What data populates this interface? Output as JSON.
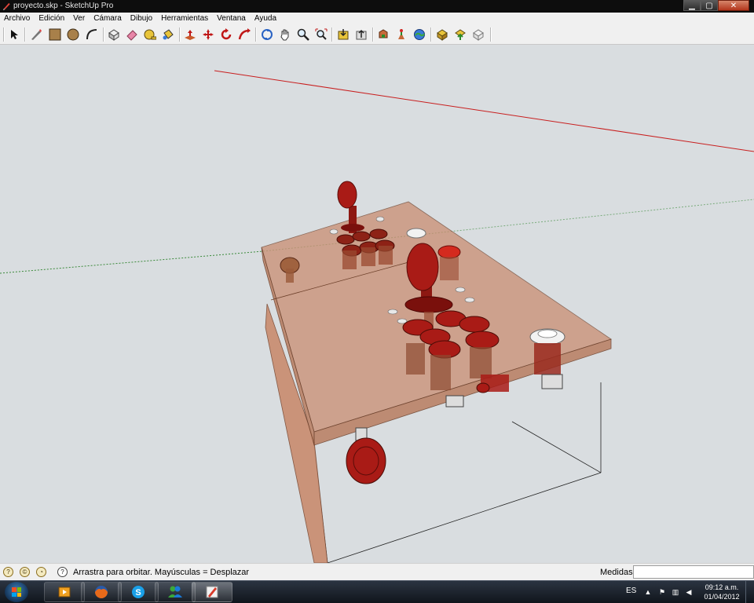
{
  "window": {
    "title": "proyecto.skp - SketchUp Pro"
  },
  "window_controls": {
    "minimize": "▁",
    "maximize": "▢",
    "close": "✕"
  },
  "menu": [
    "Archivo",
    "Edición",
    "Ver",
    "Cámara",
    "Dibujo",
    "Herramientas",
    "Ventana",
    "Ayuda"
  ],
  "toolbar": {
    "tools": [
      "select-icon",
      "pencil-line-icon",
      "rectangle-icon",
      "circle-icon",
      "arc-icon",
      "make-component-icon",
      "eraser-icon",
      "tape-measure-icon",
      "paint-bucket-icon",
      "push-pull-icon",
      "move-icon",
      "rotate-icon",
      "follow-me-icon",
      "orbit-icon",
      "pan-icon",
      "zoom-icon",
      "zoom-extents-icon",
      "get-models-icon",
      "share-model-icon",
      "get-photo-texture-icon",
      "add-location-icon",
      "toggle-terrain-icon",
      "google-earth-icon",
      "components-icon",
      "share-component-icon",
      "extension-icon"
    ]
  },
  "statusbar": {
    "icons": [
      "geo-location-icon",
      "credits-icon",
      "help-icon",
      "info-icon"
    ],
    "text": "Arrastra para orbitar. Mayúsculas = Desplazar",
    "measurements_label": "Medidas",
    "measurements_value": ""
  },
  "taskbar": {
    "apps": [
      "media-player-icon",
      "firefox-icon",
      "skype-icon",
      "messenger-icon",
      "sketchup-icon"
    ],
    "language": "ES",
    "tray_icons": [
      "show-hidden-icon",
      "action-center-icon",
      "network-icon",
      "volume-icon"
    ],
    "time": "09:12 a.m.",
    "date": "01/04/2012"
  },
  "colors": {
    "sky": "#d9dde0",
    "wood": "#c98b6e",
    "wood_edge": "#b97d60",
    "button_red": "#a91b16",
    "axis_red": "#c81e1e",
    "axis_green": "#3b8a3b"
  }
}
